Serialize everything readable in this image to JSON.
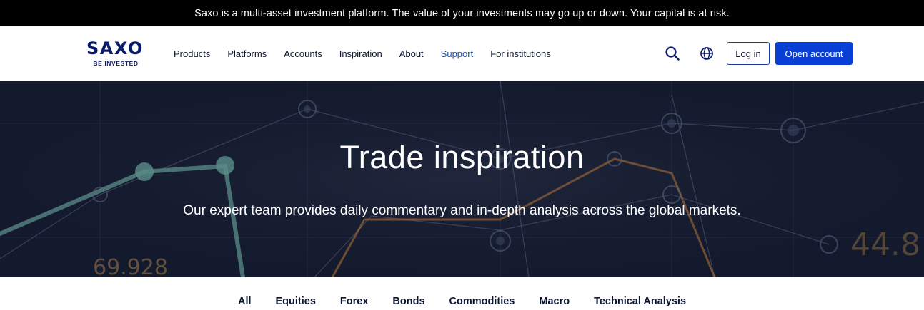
{
  "risk_banner": {
    "text": "Saxo is a multi-asset investment platform. The value of your investments may go up or down. Your capital is at risk."
  },
  "header": {
    "logo_word": "SAXO",
    "logo_tagline": "BE INVESTED",
    "nav": [
      {
        "label": "Products"
      },
      {
        "label": "Platforms"
      },
      {
        "label": "Accounts"
      },
      {
        "label": "Inspiration"
      },
      {
        "label": "About"
      },
      {
        "label": "Support"
      },
      {
        "label": "For institutions"
      }
    ],
    "search_icon": "search-icon",
    "language_icon": "globe-icon",
    "login_label": "Log in",
    "open_account_label": "Open account"
  },
  "hero": {
    "title": "Trade inspiration",
    "subtitle": "Our expert team provides daily commentary and in-depth analysis across the global markets."
  },
  "filters": [
    {
      "label": "All"
    },
    {
      "label": "Equities"
    },
    {
      "label": "Forex"
    },
    {
      "label": "Bonds"
    },
    {
      "label": "Commodities"
    },
    {
      "label": "Macro"
    },
    {
      "label": "Technical Analysis"
    }
  ],
  "colors": {
    "brand_navy": "#0a1a6b",
    "primary_button": "#0a3fd6",
    "active_nav": "#1a4fa8",
    "hero_background": "#161b2f"
  }
}
